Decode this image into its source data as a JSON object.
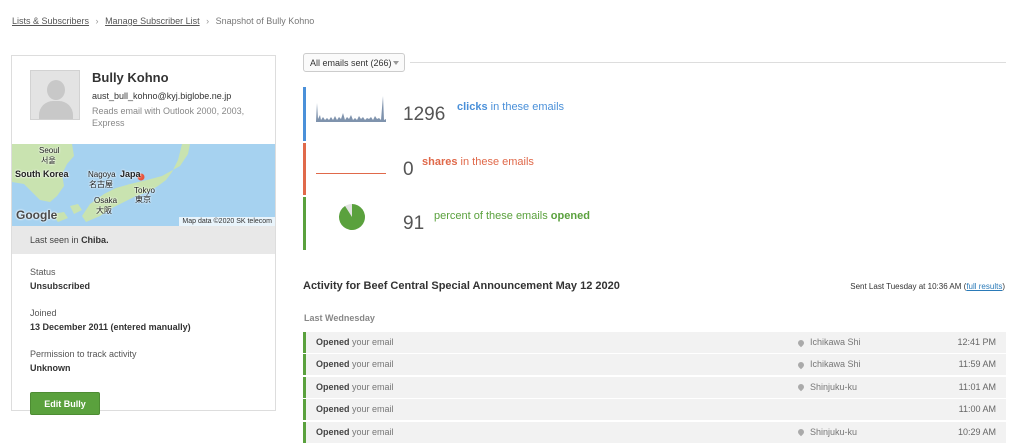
{
  "breadcrumb": {
    "item1": "Lists & Subscribers",
    "item2": "Manage Subscriber List",
    "current": "Snapshot of Bully Kohno"
  },
  "profile": {
    "name": "Bully Kohno",
    "email": "aust_bull_kohno@kyj.biglobe.ne.jp",
    "client": "Reads email with Outlook 2000, 2003, Express",
    "last_seen_prefix": "Last seen in",
    "last_seen_place": "Chiba.",
    "status_label": "Status",
    "status_value": "Unsubscribed",
    "joined_label": "Joined",
    "joined_value": "13 December 2011 (entered manually)",
    "permission_label": "Permission to track activity",
    "permission_value": "Unknown",
    "edit_button": "Edit Bully"
  },
  "map": {
    "labels": {
      "seoul": "Seoul",
      "seoul_ko": "서울",
      "south_korea": "South Korea",
      "nagoya": "Nagoya",
      "nagoya_ja": "名古屋",
      "japan": "Japa",
      "tokyo": "Tokyo",
      "tokyo_ja": "東京",
      "osaka": "Osaka",
      "osaka_ja": "大阪"
    },
    "logo": "Google",
    "attribution": "Map data ©2020 SK telecom",
    "colors": {
      "water": "#a6d2f0",
      "land": "#c9e3b0",
      "marker": "#e8543d"
    }
  },
  "filter": {
    "selected": "All emails sent (266)"
  },
  "stats": {
    "clicks": {
      "number": "1296",
      "label": "clicks",
      "suffix": " in these emails",
      "color": "#4a90d9"
    },
    "shares": {
      "number": "0",
      "label": "shares",
      "suffix": " in these emails",
      "color": "#e0694a"
    },
    "opened": {
      "number": "91",
      "prefix": "percent of these emails ",
      "label": "opened",
      "color": "#5aa13d",
      "percent": 91
    }
  },
  "activity": {
    "title": "Activity for Beef Central Special Announcement May 12 2020",
    "sent_prefix": "Sent Last Tuesday at 10:36 AM (",
    "full_results": "full results",
    "sent_suffix": ")",
    "day_label": "Last Wednesday",
    "rows": [
      {
        "event": "Opened",
        "detail": " your email",
        "location": "Ichikawa Shi",
        "time": "12:41 PM"
      },
      {
        "event": "Opened",
        "detail": " your email",
        "location": "Ichikawa Shi",
        "time": "11:59 AM"
      },
      {
        "event": "Opened",
        "detail": " your email",
        "location": "Shinjuku-ku",
        "time": "11:01 AM"
      },
      {
        "event": "Opened",
        "detail": " your email",
        "location": "",
        "time": "11:00 AM"
      },
      {
        "event": "Opened",
        "detail": " your email",
        "location": "Shinjuku-ku",
        "time": "10:29 AM"
      }
    ]
  }
}
